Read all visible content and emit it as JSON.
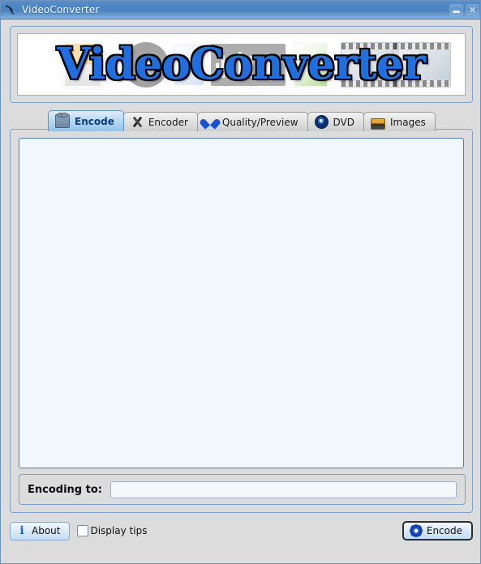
{
  "window": {
    "title": "VideoConverter",
    "title_icon": "app-bird-icon",
    "minimize_label": "",
    "close_label": "✕",
    "background_color": "#dcdcdc",
    "titlebar_color": "#4d86c4"
  },
  "banner": {
    "wordmark": "VideoConverter",
    "wordmark_color": "#1f6fe0",
    "wordmark_outline_color": "#000000"
  },
  "tabs": [
    {
      "label": "Encode",
      "icon": "film-camera-icon",
      "active": true
    },
    {
      "label": "Encoder",
      "icon": "tools-icon",
      "active": false
    },
    {
      "label": "Quality/Preview",
      "icon": "heart-icon",
      "active": false
    },
    {
      "label": "DVD",
      "icon": "disc-icon",
      "active": false
    },
    {
      "label": "Images",
      "icon": "images-card-icon",
      "active": false
    }
  ],
  "content": {
    "pane_text": "",
    "pane_background": "#f2f7fd"
  },
  "encoding": {
    "label": "Encoding to:",
    "value": "",
    "placeholder": ""
  },
  "footer": {
    "about_label": "About",
    "about_icon": "info-icon",
    "tips_label": "Display tips",
    "tips_checked": false,
    "encode_label": "Encode",
    "encode_icon": "gear-icon"
  }
}
